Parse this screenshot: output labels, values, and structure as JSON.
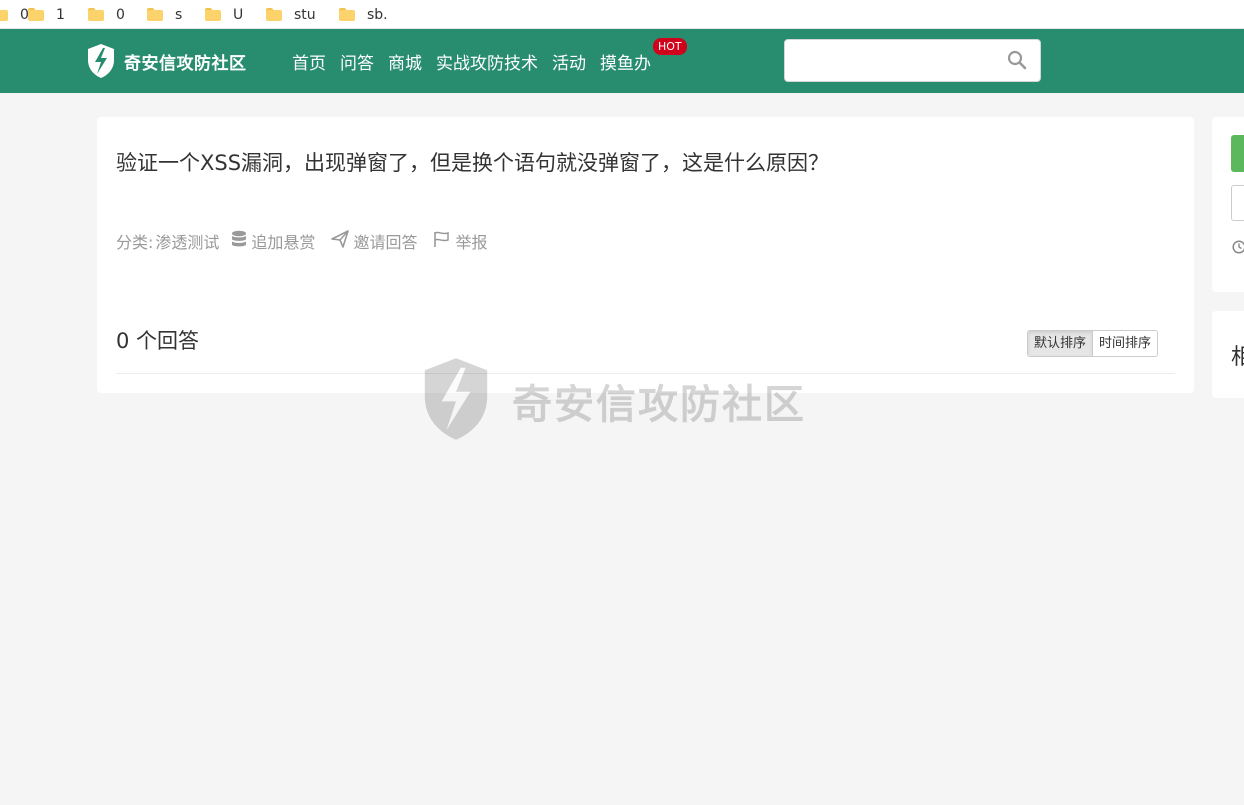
{
  "bookmarks": [
    "0",
    "1",
    "0",
    "s",
    "U",
    "stu",
    "sb."
  ],
  "header": {
    "site_name": "奇安信攻防社区",
    "nav": [
      {
        "label": "首页"
      },
      {
        "label": "问答"
      },
      {
        "label": "商城"
      },
      {
        "label": "实战攻防技术"
      },
      {
        "label": "活动"
      },
      {
        "label": "摸鱼办",
        "badge": "HOT"
      }
    ],
    "search_value": "",
    "colors": {
      "header_bg": "#288c6f",
      "badge_bg": "#d0021b"
    }
  },
  "question": {
    "title": "验证一个XSS漏洞，出现弹窗了，但是换个语句就没弹窗了，这是什么原因？",
    "category_label": "分类:",
    "category": "渗透测试",
    "actions": {
      "reward": "追加悬赏",
      "invite": "邀请回答",
      "report": "举报"
    }
  },
  "answers": {
    "count_label": "0 个回答",
    "sort_options": [
      "默认排序",
      "时间排序"
    ],
    "active_sort": "默认排序"
  },
  "watermark": {
    "text": "奇安信攻防社区"
  },
  "sidebar": {
    "partial_heading": "相"
  },
  "icons": [
    "folder-icon",
    "logo-bolt-icon",
    "search-icon",
    "database-icon",
    "paper-plane-icon",
    "flag-icon",
    "clock-icon"
  ]
}
